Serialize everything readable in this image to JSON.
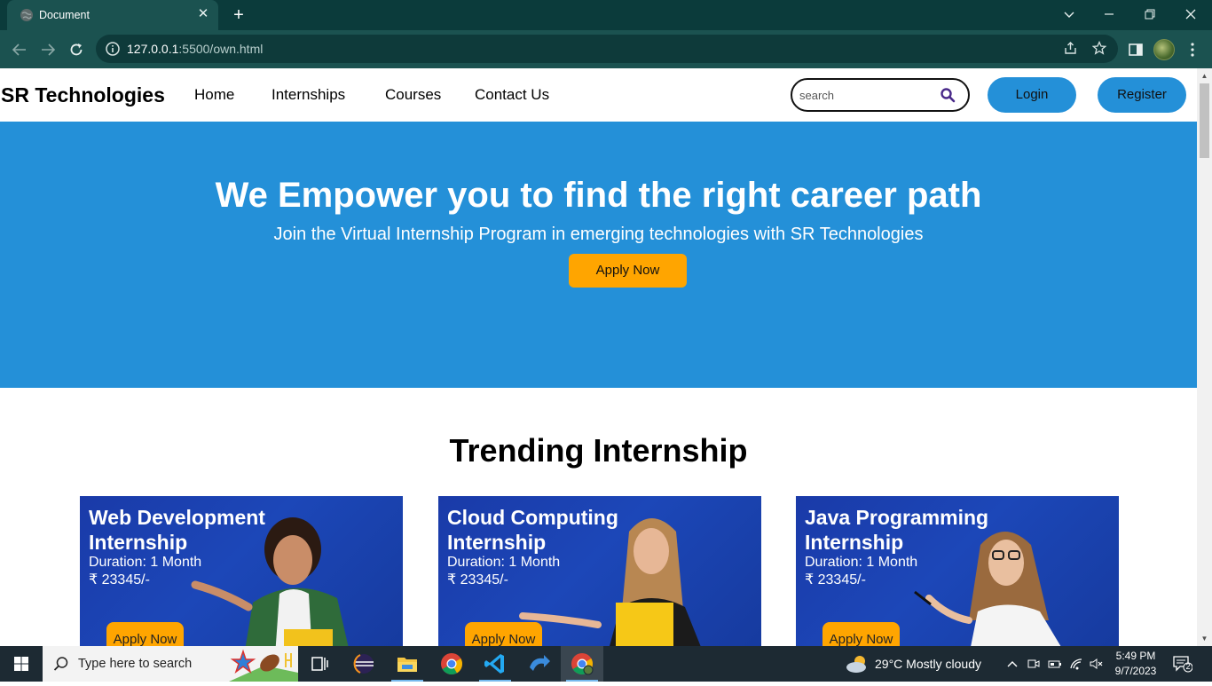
{
  "browser": {
    "tab_title": "Document",
    "url_host": "127.0.0.1",
    "url_rest": ":5500/own.html"
  },
  "site": {
    "brand": "SR Technologies",
    "nav": [
      "Home",
      "Internships",
      "Courses",
      "Contact Us"
    ],
    "search_placeholder": "search",
    "login_label": "Login",
    "register_label": "Register",
    "accent_color": "#2490d8",
    "cta_color": "#ffa500"
  },
  "hero": {
    "title": "We Empower you to find the right career path",
    "subtitle": "Join the Virtual Internship Program in emerging technologies with SR Technologies",
    "apply_label": "Apply Now"
  },
  "trending": {
    "title": "Trending Internship",
    "cards": [
      {
        "title": "Web Development Internship",
        "duration": "Duration: 1 Month",
        "price": "₹ 23345/-",
        "apply": "Apply Now"
      },
      {
        "title": "Cloud Computing Internship",
        "duration": "Duration: 1 Month",
        "price": "₹ 23345/-",
        "apply": "Apply Now"
      },
      {
        "title": "Java Programming Internship",
        "duration": "Duration: 1 Month",
        "price": "₹ 23345/-",
        "apply": "Apply Now"
      }
    ]
  },
  "taskbar": {
    "search_placeholder": "Type here to search",
    "weather": "29°C  Mostly cloudy",
    "time": "5:49 PM",
    "date": "9/7/2023",
    "notification_count": "2"
  }
}
